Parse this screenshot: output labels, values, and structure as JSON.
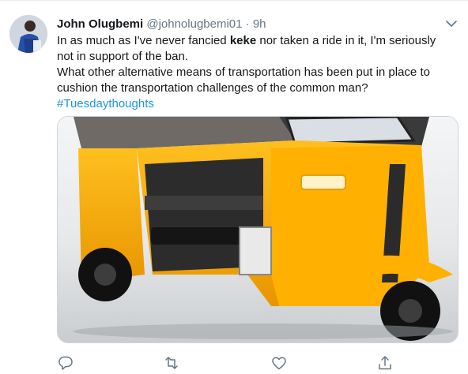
{
  "author": {
    "name": "John Olugbemi",
    "handle": "@johnolugbemi01",
    "separator": "·",
    "time": "9h"
  },
  "tweet": {
    "line1_pre": "In as much as I've never fancied ",
    "line1_bold": "keke",
    "line1_post": " nor taken a ride in it, I'm seriously not in support of the ban.",
    "line2": "What other alternative means of transportation has been put in place to cushion the transportation challenges of the common man?",
    "hashtag": "#Tuesdaythoughts"
  },
  "media": {
    "subject": "yellow tricycle (keke) photo"
  },
  "icons": [
    "reply-icon",
    "retweet-icon",
    "like-icon",
    "share-icon"
  ],
  "colors": {
    "accent": "#1b95e0",
    "secondary": "#657786",
    "vehicle": "#f5a800"
  }
}
